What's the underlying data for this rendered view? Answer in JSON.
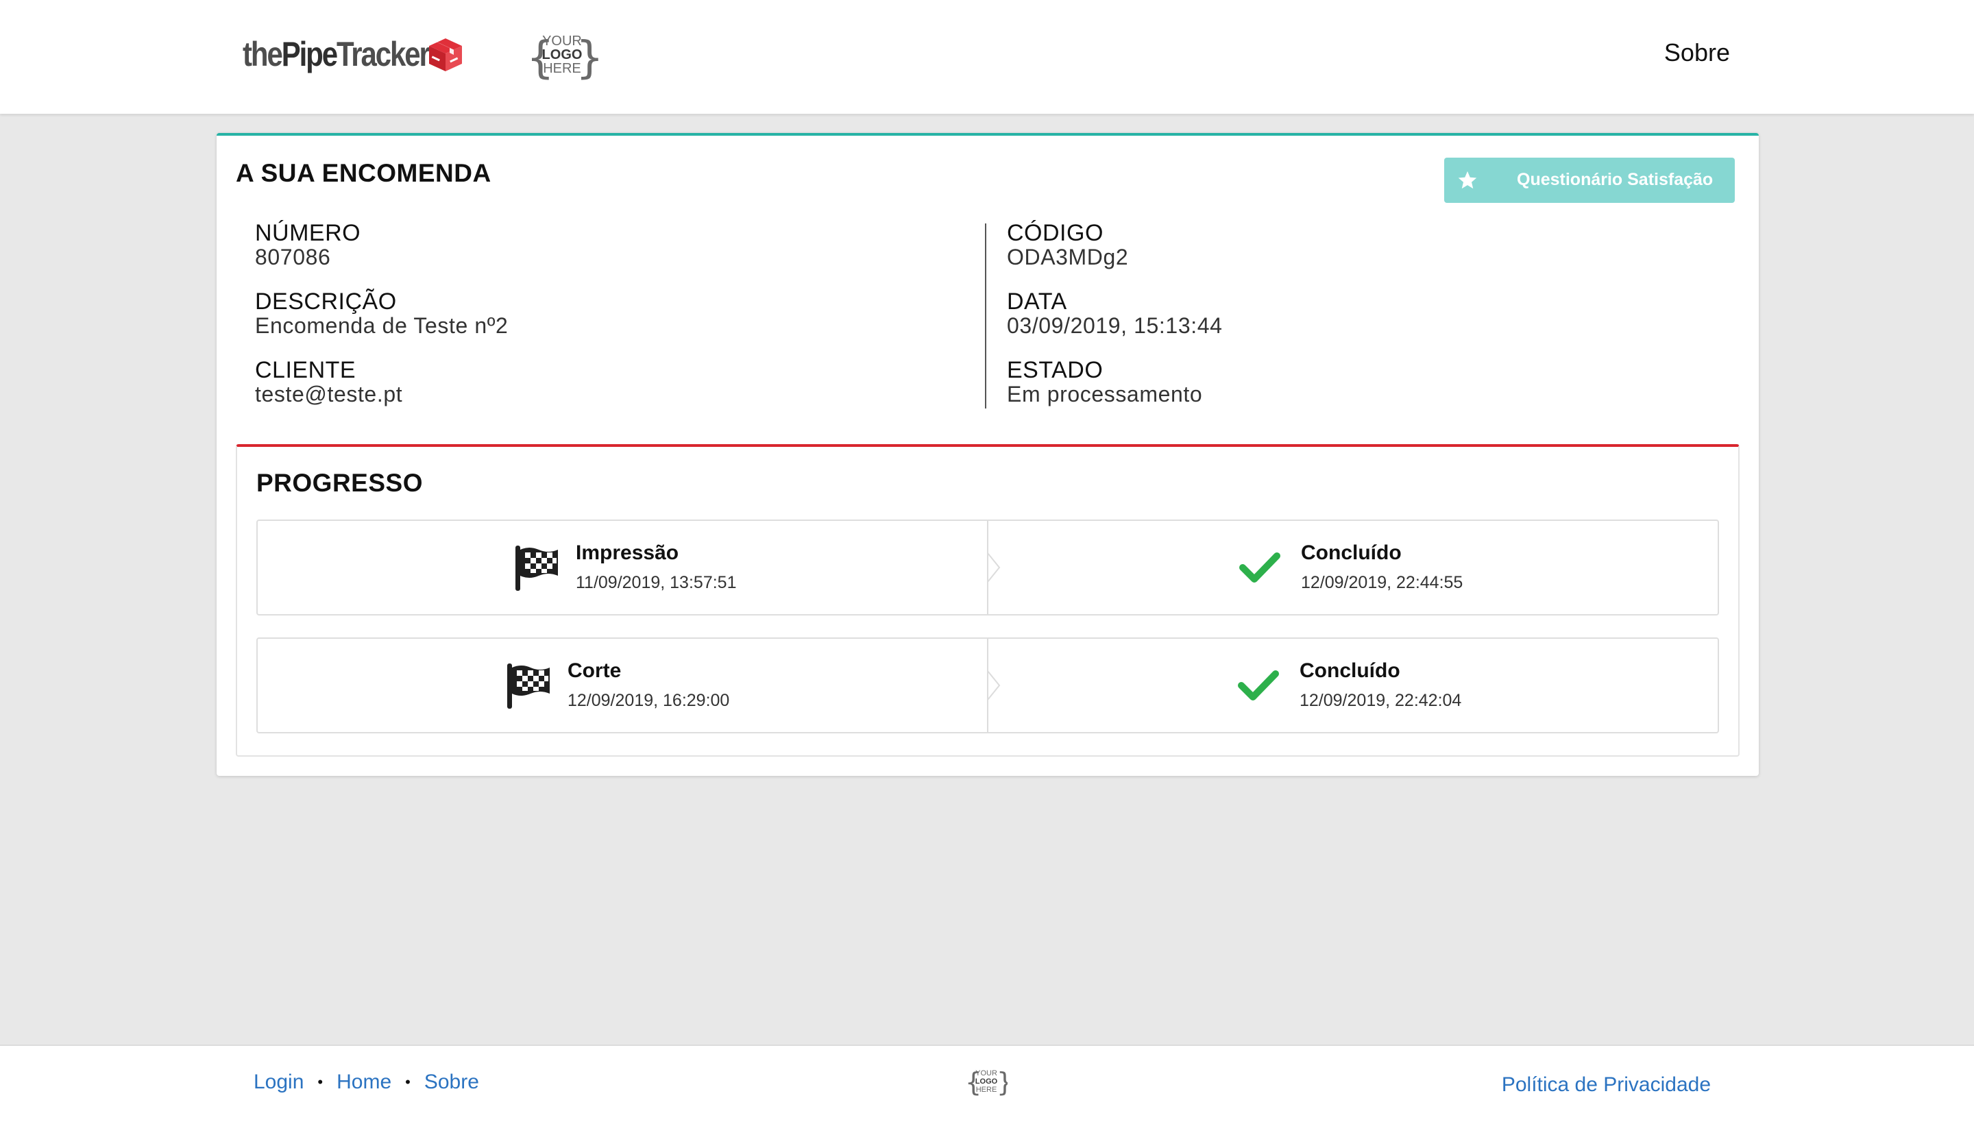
{
  "header": {
    "brand_part1": "the",
    "brand_part2": "Pipe",
    "brand_part3": "Tracker",
    "partner_logo": [
      "YOUR",
      "LOGO",
      "HERE"
    ],
    "nav_about": "Sobre"
  },
  "order": {
    "title": "A SUA ENCOMENDA",
    "survey_button": "Questionário Satisfação",
    "left": [
      {
        "label": "NÚMERO",
        "value": "807086"
      },
      {
        "label": "DESCRIÇÃO",
        "value": "Encomenda de Teste nº2"
      },
      {
        "label": "CLIENTE",
        "value": "teste@teste.pt"
      }
    ],
    "right": [
      {
        "label": "CÓDIGO",
        "value": "ODA3MDg2"
      },
      {
        "label": "DATA",
        "value": "03/09/2019, 15:13:44"
      },
      {
        "label": "ESTADO",
        "value": "Em processamento"
      }
    ]
  },
  "progress": {
    "title": "PROGRESSO",
    "steps": [
      {
        "name": "Impressão",
        "start": "11/09/2019, 13:57:51",
        "status": "Concluído",
        "end": "12/09/2019, 22:44:55"
      },
      {
        "name": "Corte",
        "start": "12/09/2019, 16:29:00",
        "status": "Concluído",
        "end": "12/09/2019, 22:42:04"
      }
    ]
  },
  "footer": {
    "links": [
      "Login",
      "Home",
      "Sobre"
    ],
    "separator": "•",
    "privacy": "Política de Privacidade"
  },
  "colors": {
    "accent_teal": "#27b3a6",
    "survey_button": "#86d7d2",
    "progress_red": "#d9262e",
    "check_green": "#2db04b",
    "link_blue": "#2b73c1",
    "brand_box_red": "#e0303a"
  },
  "icons": {
    "brand": "box-icon",
    "survey": "star-icon",
    "step_start": "checkered-flag-icon",
    "step_done": "checkmark-icon",
    "separator": "chevron-right-icon"
  }
}
